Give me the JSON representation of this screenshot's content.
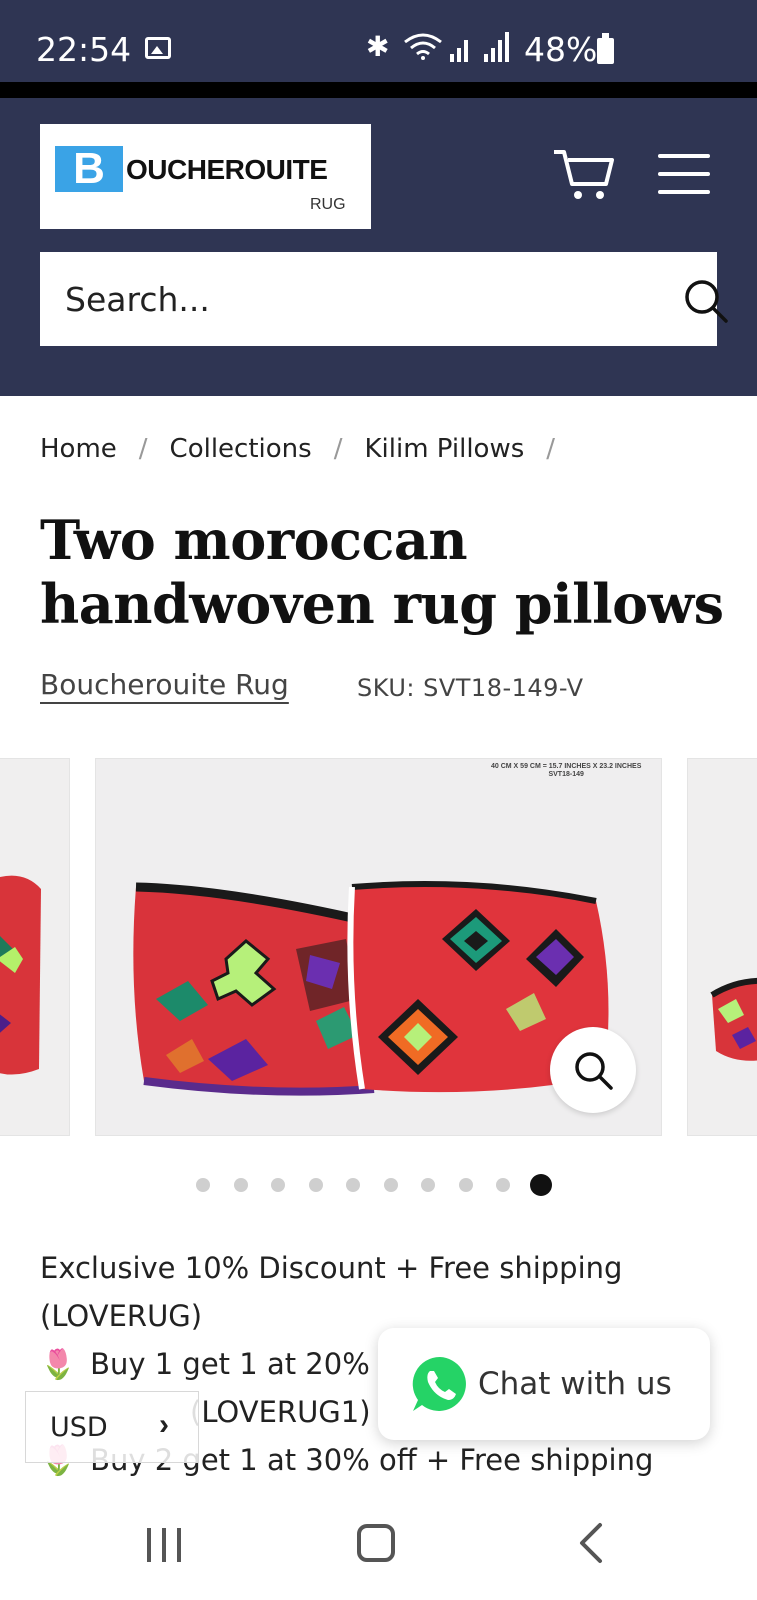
{
  "status_bar": {
    "time": "22:54",
    "battery": "48%"
  },
  "header": {
    "logo_letter": "B",
    "logo_name": "OUCHEROUITE",
    "logo_sub": "RUG",
    "icons": [
      "cart-icon",
      "menu-icon",
      "search-icon"
    ]
  },
  "search": {
    "placeholder": "Search..."
  },
  "breadcrumb": [
    "Home",
    "Collections",
    "Kilim Pillows"
  ],
  "product": {
    "title": "Two moroccan handwoven rug pillows",
    "vendor": "Boucherouite Rug",
    "sku": "SKU: SVT18-149-V",
    "image_caption_line1": "40 CM X 59 CM = 15.7 INCHES X 23.2 INCHES",
    "image_caption_line2": "SVT18-149"
  },
  "carousel": {
    "total": 10,
    "active_index": 9
  },
  "promo": {
    "line1": "Exclusive 10% Discount + Free shipping (LOVERUG)",
    "line2": "Buy 1 get 1 at 20% off + Free shipping",
    "line3": "(LOVERUG1)",
    "line4": "Buy 2 get 1 at 30% off + Free shipping",
    "bullet": "🌷"
  },
  "chat": {
    "label": "Chat with us"
  },
  "currency": {
    "code": "USD",
    "chevron": "›"
  },
  "colors": {
    "header_bg": "#2f3553",
    "logo_blue": "#3aa3e6",
    "whatsapp": "#25d366"
  }
}
